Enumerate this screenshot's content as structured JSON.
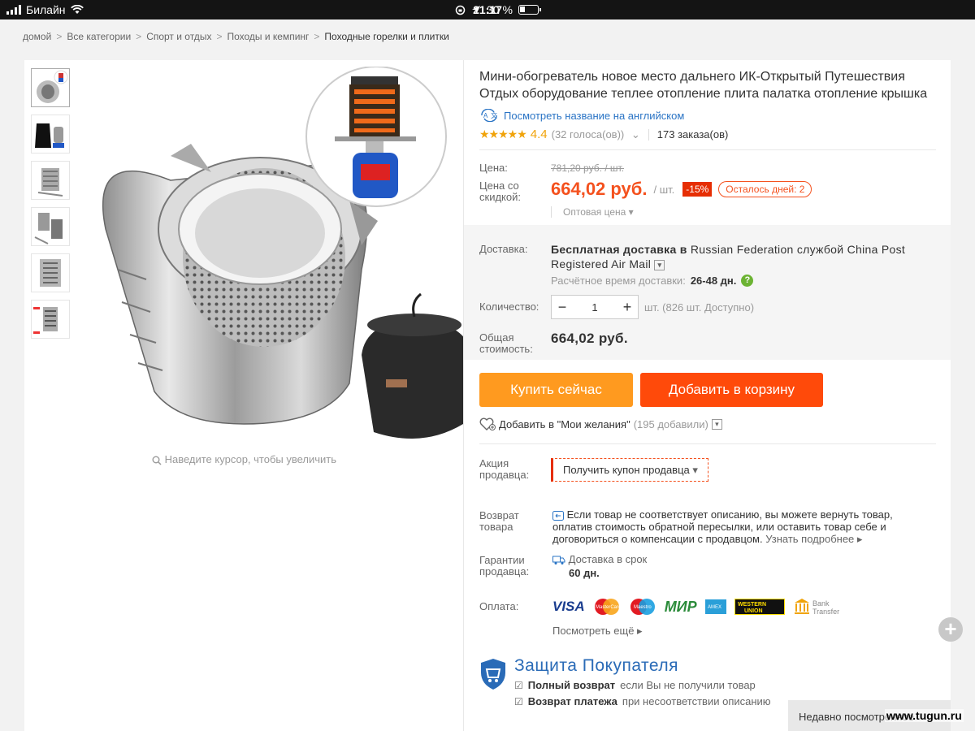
{
  "status_bar": {
    "carrier": "Билайн",
    "time": "21:17",
    "battery": "30 %"
  },
  "breadcrumb": [
    "домой",
    "Все категории",
    "Спорт и отдых",
    "Походы и кемпинг",
    "Походные горелки и плитки"
  ],
  "gallery": {
    "zoom_hint": "Наведите курсор, чтобы увеличить"
  },
  "product": {
    "title": "Мини-обогреватель новое место дальнего ИК-Открытый Путешествия Отдых оборудование теплее отопление плита палатка отопление крышка",
    "english_link": "Посмотреть название на английском",
    "rating": "4.4",
    "votes": "(32 голоса(ов))",
    "orders": "173 заказа(ов)"
  },
  "price": {
    "label": "Цена:",
    "old": "781,20 руб. / шт.",
    "discount_label": "Цена со скидкой:",
    "new": "664,02 руб.",
    "unit": "/ шт.",
    "discount": "-15%",
    "days_left": "Осталось дней: 2",
    "wholesale": "Оптовая цена"
  },
  "delivery": {
    "label": "Доставка:",
    "text_bold": "Бесплатная доставка в",
    "text_rest": "Russian Federation службой China Post Registered Air Mail",
    "estimate_label": "Расчётное время доставки:",
    "estimate_value": "26-48 дн."
  },
  "quantity": {
    "label": "Количество:",
    "value": "1",
    "available": "шт. (826 шт. Доступно)"
  },
  "total": {
    "label": "Общая стоимость:",
    "value": "664,02 руб."
  },
  "actions": {
    "buy": "Купить сейчас",
    "cart": "Добавить в корзину",
    "wish": "Добавить в \"Мои желания\"",
    "wish_count": "(195 добавили)"
  },
  "seller_promo": {
    "label": "Акция продавца:",
    "coupon": "Получить купон продавца"
  },
  "returns": {
    "label": "Возврат товара",
    "text": "Если товар не соответствует описанию, вы можете вернуть товар, оплатив стоимость обратной пересылки, или оставить товар себе и договориться о компенсации с продавцом.",
    "more": "Узнать подробнее"
  },
  "guarantee": {
    "label": "Гарантии продавца:",
    "text": "Доставка в срок",
    "days": "60 дн."
  },
  "payment": {
    "label": "Оплата:",
    "methods": [
      "VISA",
      "MasterCard",
      "Maestro",
      "МИР",
      "American Express",
      "WESTERN UNION",
      "Bank Transfer"
    ],
    "more": "Посмотреть ещё"
  },
  "protection": {
    "title": "Защита Покупателя",
    "row1_bold": "Полный возврат",
    "row1_rest": "если Вы не получили товар",
    "row2_bold": "Возврат платежа",
    "row2_rest": "при несоответствии описанию"
  },
  "recently_viewed": "Недавно посмотренное",
  "watermark": "www.tugun.ru",
  "colors": {
    "accent": "#f4511e",
    "buy": "#ff9a1f",
    "cart": "#ff4a0a",
    "link": "#2a74c5"
  }
}
